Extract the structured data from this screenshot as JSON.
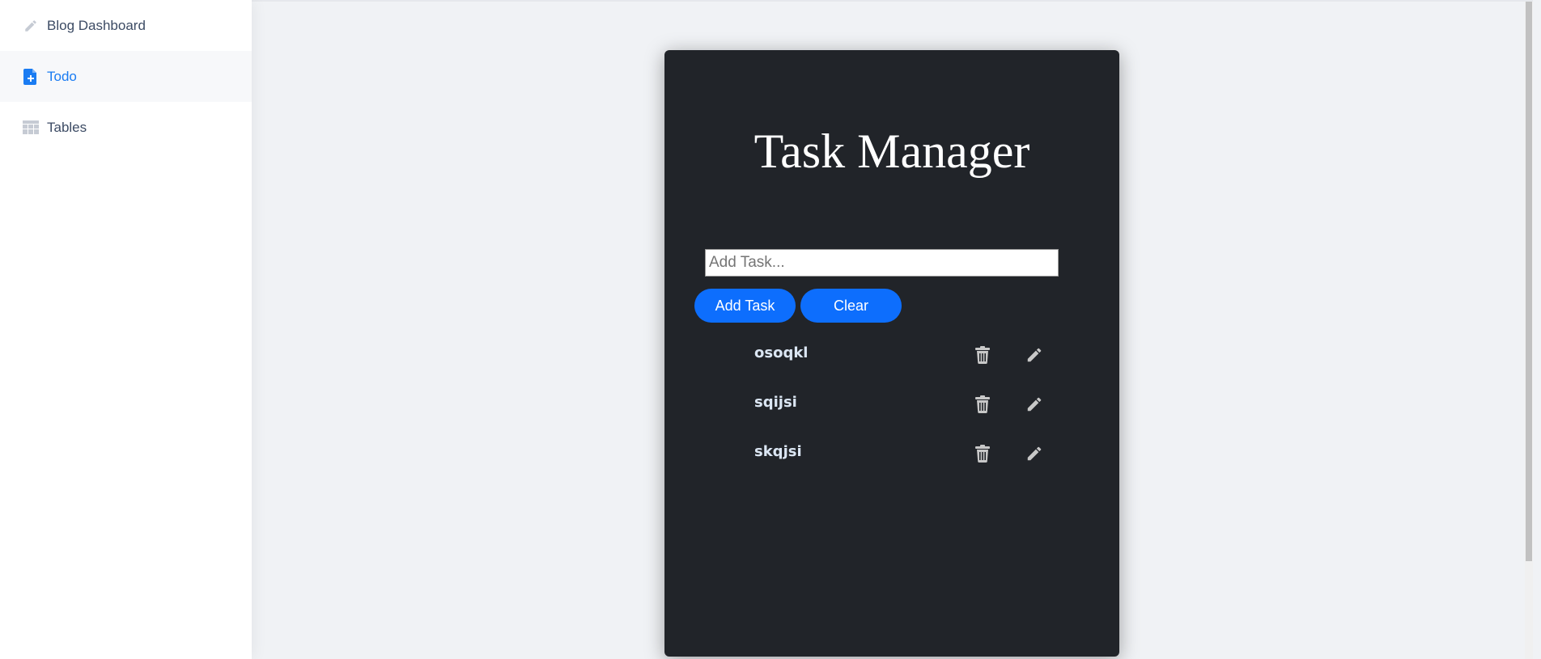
{
  "sidebar": {
    "items": [
      {
        "label": "Blog Dashboard",
        "icon": "pencil-icon",
        "active": false
      },
      {
        "label": "Todo",
        "icon": "file-plus-icon",
        "active": true
      },
      {
        "label": "Tables",
        "icon": "table-icon",
        "active": false
      }
    ]
  },
  "card": {
    "title": "Task Manager",
    "input": {
      "placeholder": "Add Task...",
      "value": ""
    },
    "add_button": "Add Task",
    "clear_button": "Clear",
    "tasks": [
      {
        "text": "osoqkl"
      },
      {
        "text": "sqijsi"
      },
      {
        "text": "skqjsi"
      }
    ]
  },
  "colors": {
    "accent": "#0d6efd",
    "active_nav": "#1a7cf2",
    "card_bg": "#212429",
    "page_bg": "#f0f2f5",
    "task_text": "#dbe6f3",
    "icon_gray": "#c8c8c8"
  }
}
